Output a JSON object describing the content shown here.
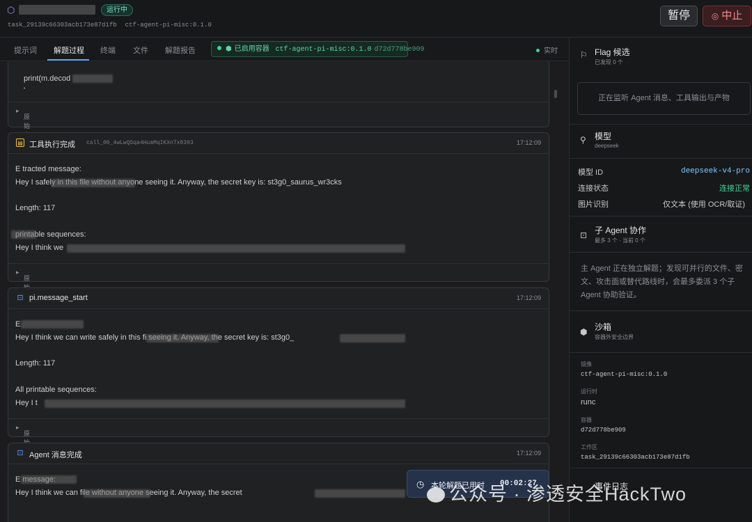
{
  "header": {
    "status_badge": "运行中",
    "task_id": "task_29139c66303acb173e87d1fb",
    "agent_version": "ctf-agent-pi-misc:0.1.0",
    "pause_label": "暂停",
    "stop_label": "中止"
  },
  "tabs": [
    {
      "label": "提示词"
    },
    {
      "label": "解题过程"
    },
    {
      "label": "终端"
    },
    {
      "label": "文件"
    },
    {
      "label": "解题报告"
    }
  ],
  "container_chip": {
    "label": "已启用容器",
    "image": "ctf-agent-pi-misc:0.1.0",
    "hash": "d72d778be909"
  },
  "realtime_label": "实时",
  "raw_events_label": "原始事件数据",
  "cards": [
    {
      "lines": [
        "print(m.decod",
        "'"
      ]
    },
    {
      "icon": "tool-icon",
      "title": "工具执行完成",
      "call_id": "call_00_4wLwQSqa4HuaMqIKXnTx8393",
      "time": "17:12:09",
      "lines": [
        "E tracted message:",
        "Hey I                      safely in this file without anyone seeing it. Anyway, the secret key is: st3g0_saurus_wr3cks",
        "Length: 117",
        "     printable sequences:",
        "Hey I think we"
      ]
    },
    {
      "icon": "bot-icon",
      "title": "pi.message_start",
      "time": "17:12:09",
      "lines": [
        "E",
        "Hey I think we can write safely in this fi                        seeing it. Anyway, the secret key is: st3g0_",
        "Length: 117",
        "All printable sequences:",
        "Hey I t"
      ]
    },
    {
      "icon": "bot-icon",
      "title": "Agent 消息完成",
      "time": "17:12:09",
      "lines": [
        "E              message:",
        "Hey I think we can                    file without anyone seeing it. Anyway, the secret"
      ]
    }
  ],
  "toast": {
    "label": "本轮解题已用时",
    "value": "00:02:27"
  },
  "sidebar": {
    "flag": {
      "title": "Flag 候选",
      "sub": "已发现 0 个",
      "listening": "正在监听 Agent 消息、工具输出与产物"
    },
    "model": {
      "title": "模型",
      "sub": "deepseek",
      "rows": [
        {
          "k": "模型 ID",
          "v": "deepseek-v4-pro"
        },
        {
          "k": "连接状态",
          "v": "连接正常"
        },
        {
          "k": "图片识别",
          "v": "仅文本 (使用 OCR/取证)"
        }
      ]
    },
    "subagent": {
      "title": "子 Agent 协作",
      "sub": "最多 3 个 · 当前 0 个",
      "desc": "主 Agent 正在独立解题；发现可并行的文件、密文、攻击面或替代路线时，会最多委派 3 个子 Agent 协助验证。"
    },
    "sandbox": {
      "title": "沙箱",
      "sub": "容器外安全边界",
      "image_k": "镜像",
      "image_v": "ctf-agent-pi-misc:0.1.0",
      "runtime_k": "运行时",
      "runtime_v": "runc",
      "container_k": "容器",
      "container_v": "d72d778be909",
      "workdir_k": "工作区",
      "workdir_v": "task_29139c66303acb173e87d1fb"
    },
    "events_label": "事件日志"
  },
  "watermark": "公众号 · 渗透安全HackTwo",
  "colors": {
    "accent": "#5ea3ff",
    "ok": "#3ed598",
    "danger": "#f28b8f",
    "badge": "#7ee2c2"
  }
}
